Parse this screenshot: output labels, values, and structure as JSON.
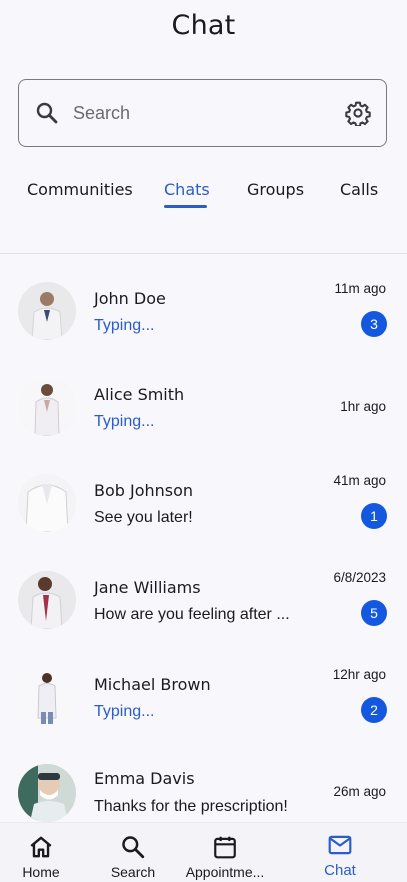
{
  "header": {
    "title": "Chat"
  },
  "search": {
    "placeholder": "Search"
  },
  "tabs": [
    {
      "label": "Communities"
    },
    {
      "label": "Chats"
    },
    {
      "label": "Groups"
    },
    {
      "label": "Calls"
    }
  ],
  "active_tab": "Chats",
  "chats": [
    {
      "name": "John Doe",
      "message": "Typing...",
      "typing": true,
      "time": "11m ago",
      "unread": "3"
    },
    {
      "name": "Alice Smith",
      "message": "Typing...",
      "typing": true,
      "time": "1hr ago",
      "unread": ""
    },
    {
      "name": "Bob Johnson",
      "message": "See you later!",
      "typing": false,
      "time": "41m ago",
      "unread": "1"
    },
    {
      "name": "Jane Williams",
      "message": "How are you feeling after ...",
      "typing": false,
      "time": "6/8/2023",
      "unread": "5"
    },
    {
      "name": "Michael Brown",
      "message": "Typing...",
      "typing": true,
      "time": "12hr ago",
      "unread": "2"
    },
    {
      "name": "Emma Davis",
      "message": "Thanks for the prescription!",
      "typing": false,
      "time": "26m ago",
      "unread": ""
    }
  ],
  "nav": {
    "home": "Home",
    "search": "Search",
    "appointments": "Appointme...",
    "chat": "Chat"
  },
  "colors": {
    "accent": "#2a5dc8",
    "badge": "#1558e0",
    "background": "#f8f7fb"
  },
  "icons": {
    "search": "search-icon",
    "settings": "gear-icon",
    "home": "home-icon",
    "calendar": "calendar-icon",
    "mail": "mail-icon"
  }
}
